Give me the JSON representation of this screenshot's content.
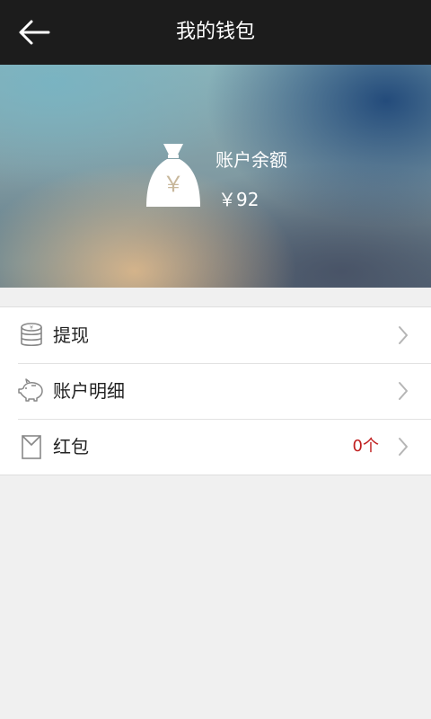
{
  "header": {
    "title": "我的钱包",
    "back_icon": "arrow-left-icon"
  },
  "balance": {
    "label": "账户余额",
    "amount": "￥92",
    "icon": "money-bag-icon",
    "icon_symbol": "￥"
  },
  "menu": {
    "items": [
      {
        "label": "提现",
        "icon": "coin-stack-icon",
        "badge": ""
      },
      {
        "label": "账户明细",
        "icon": "piggy-bank-icon",
        "badge": ""
      },
      {
        "label": "红包",
        "icon": "envelope-icon",
        "badge": "0个"
      }
    ]
  },
  "colors": {
    "topbar": "#1c1c1c",
    "badge": "#c01e1e",
    "background": "#f0f0f0"
  }
}
